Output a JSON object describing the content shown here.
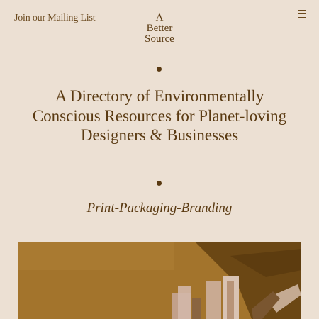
{
  "header": {
    "mailing_link": "Join our Mailing List",
    "logo_lines": [
      "A",
      "Better",
      "Source"
    ],
    "menu_icon": "hamburger-menu-icon"
  },
  "hero": {
    "headline": "A Directory of Environmentally Conscious Resources for Planet-loving Designers & Businesses",
    "tagline": "Print-Packaging-Branding"
  },
  "colors": {
    "background": "#ece0d3",
    "text": "#5a3a12",
    "image_tint": "#a3742c"
  }
}
